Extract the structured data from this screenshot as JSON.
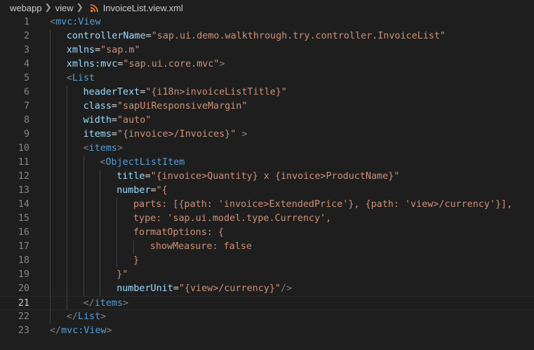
{
  "breadcrumb": [
    "webapp",
    "view",
    "InvoiceList.view.xml"
  ],
  "icons": {
    "separator": "chevron-right-icon",
    "file": "rss-file-icon"
  },
  "colors": {
    "background": "#1e1e1e",
    "tag": "#569cd6",
    "bracket": "#808080",
    "attribute": "#9cdcfe",
    "string": "#ce9178",
    "text": "#d4d4d4",
    "line_number": "#858585",
    "file_icon": "#e37933"
  },
  "editor": {
    "active_line": 21,
    "lines": [
      {
        "n": "1",
        "indent": 0,
        "tokens": [
          [
            "b",
            "<"
          ],
          [
            "t",
            "mvc:View"
          ]
        ]
      },
      {
        "n": "2",
        "indent": 1,
        "tokens": [
          [
            "a",
            "controllerName"
          ],
          [
            "p",
            "="
          ],
          [
            "s",
            "\"sap.ui.demo.walkthrough.try.controller.InvoiceList\""
          ]
        ]
      },
      {
        "n": "3",
        "indent": 1,
        "tokens": [
          [
            "a",
            "xmlns"
          ],
          [
            "p",
            "="
          ],
          [
            "s",
            "\"sap.m\""
          ]
        ]
      },
      {
        "n": "4",
        "indent": 1,
        "tokens": [
          [
            "a",
            "xmlns:mvc"
          ],
          [
            "p",
            "="
          ],
          [
            "s",
            "\"sap.ui.core.mvc\""
          ],
          [
            "b",
            ">"
          ]
        ]
      },
      {
        "n": "5",
        "indent": 1,
        "tokens": [
          [
            "b",
            "<"
          ],
          [
            "t",
            "List"
          ]
        ]
      },
      {
        "n": "6",
        "indent": 2,
        "tokens": [
          [
            "a",
            "headerText"
          ],
          [
            "p",
            "="
          ],
          [
            "s",
            "\"{i18n>invoiceListTitle}\""
          ]
        ]
      },
      {
        "n": "7",
        "indent": 2,
        "tokens": [
          [
            "a",
            "class"
          ],
          [
            "p",
            "="
          ],
          [
            "s",
            "\"sapUiResponsiveMargin\""
          ]
        ]
      },
      {
        "n": "8",
        "indent": 2,
        "tokens": [
          [
            "a",
            "width"
          ],
          [
            "p",
            "="
          ],
          [
            "s",
            "\"auto\""
          ]
        ]
      },
      {
        "n": "9",
        "indent": 2,
        "tokens": [
          [
            "a",
            "items"
          ],
          [
            "p",
            "="
          ],
          [
            "s",
            "\"{invoice>/Invoices}\""
          ],
          [
            "p",
            " "
          ],
          [
            "b",
            ">"
          ]
        ]
      },
      {
        "n": "10",
        "indent": 2,
        "tokens": [
          [
            "b",
            "<"
          ],
          [
            "t",
            "items"
          ],
          [
            "b",
            ">"
          ]
        ]
      },
      {
        "n": "11",
        "indent": 3,
        "tokens": [
          [
            "b",
            "<"
          ],
          [
            "t",
            "ObjectListItem"
          ]
        ]
      },
      {
        "n": "12",
        "indent": 4,
        "tokens": [
          [
            "a",
            "title"
          ],
          [
            "p",
            "="
          ],
          [
            "s",
            "\"{invoice>Quantity} x {invoice>ProductName}\""
          ]
        ]
      },
      {
        "n": "13",
        "indent": 4,
        "tokens": [
          [
            "a",
            "number"
          ],
          [
            "p",
            "="
          ],
          [
            "s",
            "\"{"
          ]
        ]
      },
      {
        "n": "14",
        "indent": 5,
        "tokens": [
          [
            "s",
            "parts: [{path: 'invoice>ExtendedPrice'}, {path: 'view>/currency'}],"
          ]
        ]
      },
      {
        "n": "15",
        "indent": 5,
        "tokens": [
          [
            "s",
            "type: 'sap.ui.model.type.Currency',"
          ]
        ]
      },
      {
        "n": "16",
        "indent": 5,
        "tokens": [
          [
            "s",
            "formatOptions: {"
          ]
        ]
      },
      {
        "n": "17",
        "indent": 6,
        "tokens": [
          [
            "s",
            "showMeasure: false"
          ]
        ]
      },
      {
        "n": "18",
        "indent": 5,
        "tokens": [
          [
            "s",
            "}"
          ]
        ]
      },
      {
        "n": "19",
        "indent": 4,
        "tokens": [
          [
            "s",
            "}\""
          ]
        ]
      },
      {
        "n": "20",
        "indent": 4,
        "tokens": [
          [
            "a",
            "numberUnit"
          ],
          [
            "p",
            "="
          ],
          [
            "s",
            "\"{view>/currency}\""
          ],
          [
            "b",
            "/>"
          ]
        ]
      },
      {
        "n": "21",
        "indent": 2,
        "tokens": [
          [
            "b",
            "</"
          ],
          [
            "t",
            "items"
          ],
          [
            "b",
            ">"
          ]
        ]
      },
      {
        "n": "22",
        "indent": 1,
        "tokens": [
          [
            "b",
            "</"
          ],
          [
            "t",
            "List"
          ],
          [
            "b",
            ">"
          ]
        ]
      },
      {
        "n": "23",
        "indent": 0,
        "tokens": [
          [
            "b",
            "</"
          ],
          [
            "t",
            "mvc:View"
          ],
          [
            "b",
            ">"
          ]
        ]
      }
    ]
  }
}
